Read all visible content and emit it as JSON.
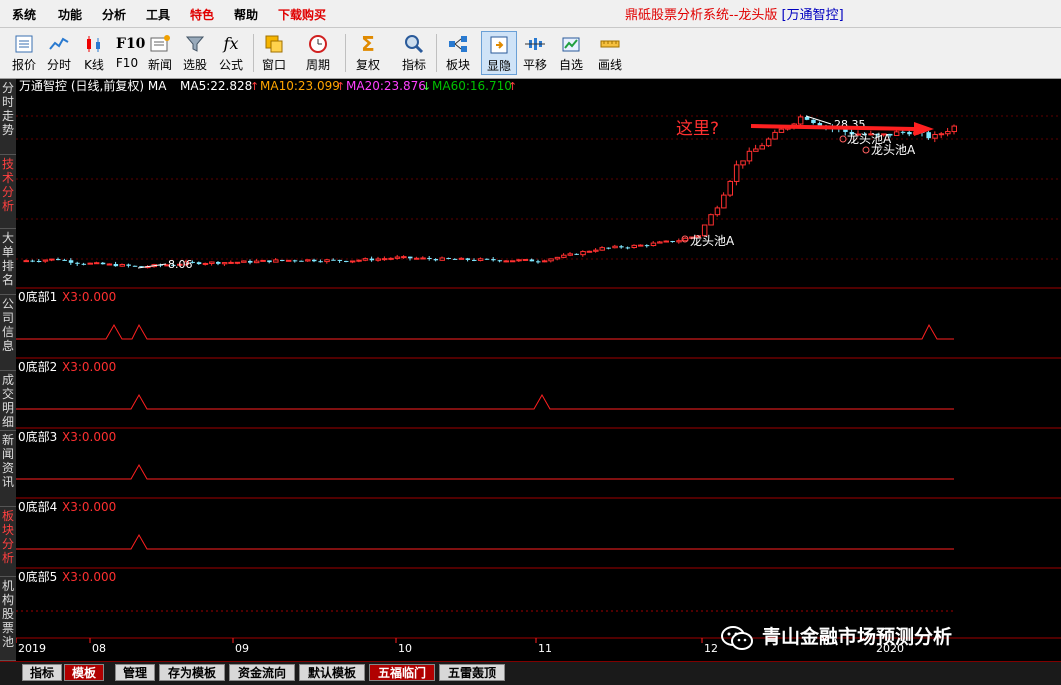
{
  "menubar": {
    "items": [
      "系统",
      "功能",
      "分析",
      "工具",
      "特色",
      "帮助",
      "下载购买"
    ],
    "title_main": "鼎砥股票分析系统--龙头版",
    "title_bracket": "[万通智控]"
  },
  "toolbar": {
    "buttons": [
      {
        "label": "报价",
        "icon": "quote-icon"
      },
      {
        "label": "分时",
        "icon": "intraday-icon"
      },
      {
        "label": "K线",
        "icon": "kline-icon"
      },
      {
        "label": "F10",
        "icon": "f10-icon"
      },
      {
        "label": "新闻",
        "icon": "news-icon"
      },
      {
        "label": "选股",
        "icon": "stock-picker-icon"
      },
      {
        "label": "公式",
        "icon": "formula-icon"
      },
      {
        "label": "窗口",
        "icon": "window-icon"
      },
      {
        "label": "周期",
        "icon": "period-icon"
      },
      {
        "label": "复权",
        "icon": "rights-adjust-icon"
      },
      {
        "label": "指标",
        "icon": "indicator-icon"
      },
      {
        "label": "板块",
        "icon": "sector-icon"
      },
      {
        "label": "显隐",
        "icon": "show-hide-icon"
      },
      {
        "label": "平移",
        "icon": "pan-icon"
      },
      {
        "label": "自选",
        "icon": "watchlist-icon"
      },
      {
        "label": "画线",
        "icon": "draw-line-icon"
      }
    ]
  },
  "sidebar": {
    "tabs": [
      "分时走势",
      "技术分析",
      "大单排名",
      "公司信息",
      "成交明细",
      "新闻资讯",
      "板块分析",
      "机构股票池"
    ]
  },
  "main_chart": {
    "stock": "万通智控",
    "mode": "(日线,前复权)",
    "ma_label": "MA",
    "ma5": "MA5:22.828",
    "ma10": "MA10:23.099",
    "ma20": "MA20:23.876",
    "ma60": "MA60:16.710",
    "ma5_color": "#ffffff",
    "ma10_color": "#ffa500",
    "ma20_color": "#ff40ff",
    "ma60_color": "#00c000",
    "high_label": "28.35",
    "low_label": "8.06",
    "annotation_question": "这里?",
    "pool_label": "龙头池A",
    "pool_label2": "龙头池A",
    "pool_label3": "龙头池A",
    "up_color": "#ff3030",
    "down_color": "#80e8ff"
  },
  "indicator_panes": [
    {
      "title": "0底部1",
      "value": "X3:0.000"
    },
    {
      "title": "0底部2",
      "value": "X3:0.000"
    },
    {
      "title": "0底部3",
      "value": "X3:0.000"
    },
    {
      "title": "0底部4",
      "value": "X3:0.000"
    },
    {
      "title": "0底部5",
      "value": "X3:0.000"
    }
  ],
  "xaxis": {
    "labels": [
      "2019",
      "08",
      "09",
      "10",
      "11",
      "12",
      "2020"
    ]
  },
  "bottom_tabs": [
    "指标",
    "模板",
    "管理",
    "存为模板",
    "资金流向",
    "默认模板",
    "五福临门",
    "五雷轰顶"
  ],
  "watermark": "青山金融市场预测分析",
  "chart_data": {
    "type": "candlestick",
    "x": [
      "2019-07",
      "2019-08",
      "2019-09",
      "2019-10",
      "2019-11",
      "2019-12",
      "2020-01"
    ],
    "close_approx": [
      8.9,
      8.4,
      8.8,
      9.2,
      9.0,
      10.6,
      26.5
    ],
    "high": 28.35,
    "low": 8.06,
    "series": [
      {
        "name": "MA5",
        "last": 22.828
      },
      {
        "name": "MA10",
        "last": 23.099
      },
      {
        "name": "MA20",
        "last": 23.876
      },
      {
        "name": "MA60",
        "last": 16.71
      }
    ]
  }
}
